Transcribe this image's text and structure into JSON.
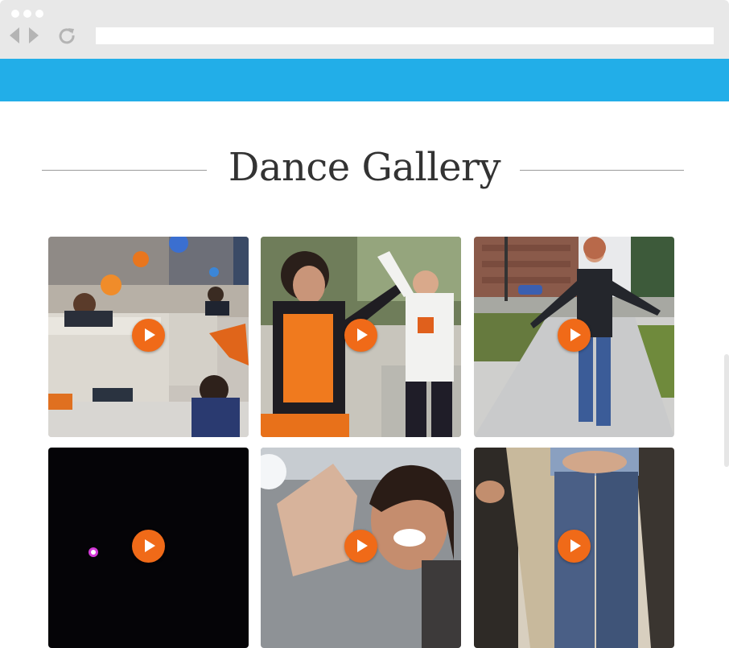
{
  "browser": {
    "url": "",
    "url_placeholder": ""
  },
  "header": {
    "color": "#22aee8"
  },
  "page": {
    "title": "Dance Gallery"
  },
  "gallery": {
    "accent": "#f06a18",
    "items": [
      {
        "scene": "office-cubicles-celebration",
        "play_icon": "play-icon"
      },
      {
        "scene": "two-women-dancing-outdoors",
        "play_icon": "play-icon"
      },
      {
        "scene": "woman-dancing-on-sidewalk",
        "play_icon": "play-icon"
      },
      {
        "scene": "dark-night-lights",
        "play_icon": "play-icon"
      },
      {
        "scene": "smiling-woman-waving",
        "play_icon": "play-icon"
      },
      {
        "scene": "legs-jeans-closeup",
        "play_icon": "play-icon"
      }
    ]
  }
}
